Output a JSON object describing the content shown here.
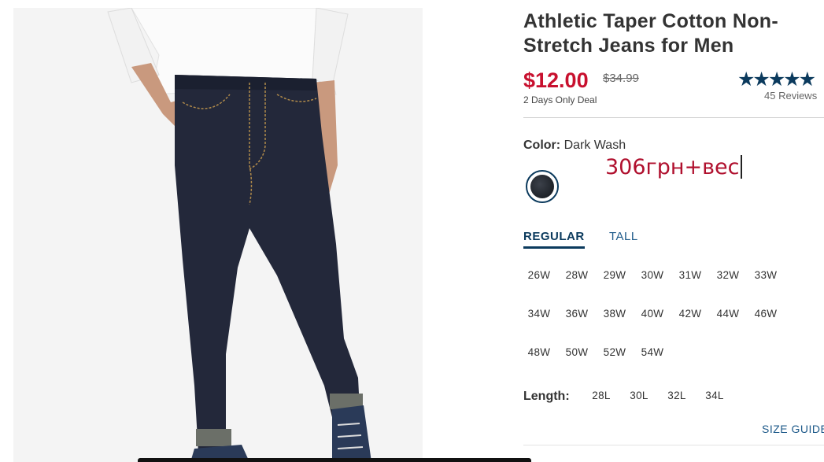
{
  "product": {
    "title": "Athletic Taper Cotton Non-Stretch Jeans for Men",
    "price": "$12.00",
    "old_price": "$34.99",
    "deal": "2 Days Only Deal",
    "stars": "★★★★★",
    "reviews": "45 Reviews"
  },
  "color": {
    "label": "Color:",
    "value": "Dark Wash",
    "swatch_color": "#23272d",
    "accent": "#0b3a5d"
  },
  "overlay_note": "306грн+вес",
  "fit_tabs": {
    "regular": "REGULAR",
    "tall": "TALL"
  },
  "waist_sizes": [
    [
      "26W",
      "28W",
      "29W",
      "30W",
      "31W",
      "32W",
      "33W"
    ],
    [
      "34W",
      "36W",
      "38W",
      "40W",
      "42W",
      "44W",
      "46W"
    ],
    [
      "48W",
      "50W",
      "52W",
      "54W"
    ]
  ],
  "length": {
    "label": "Length:",
    "options": [
      "28L",
      "30L",
      "32L",
      "34L"
    ]
  },
  "size_guide": "SIZE GUIDE",
  "colors": {
    "price_red": "#c8102e",
    "brand_navy": "#0b3a5d",
    "link_blue": "#1e5a8a"
  }
}
